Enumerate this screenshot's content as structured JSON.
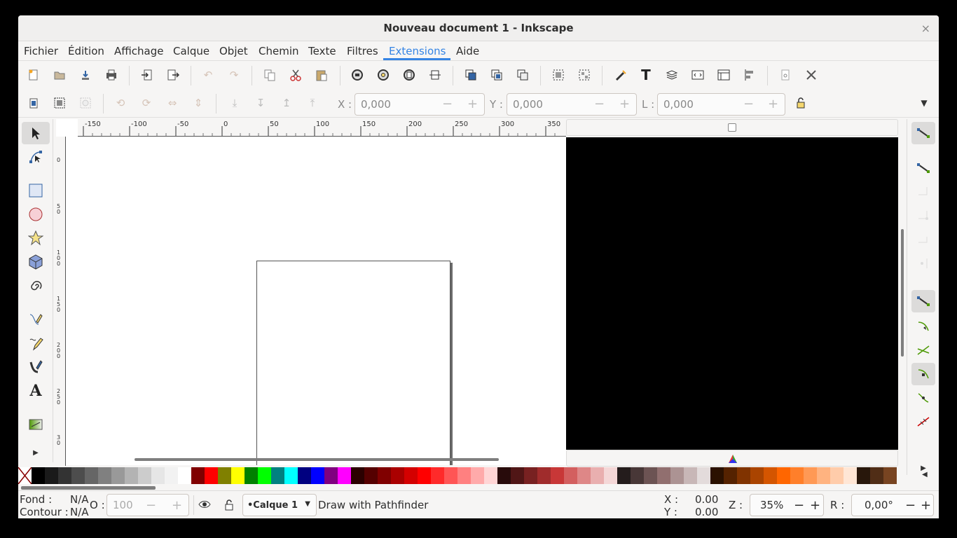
{
  "window": {
    "title": "Nouveau document 1 - Inkscape",
    "close_glyph": "×"
  },
  "menu": {
    "items": [
      "Fichier",
      "Édition",
      "Affichage",
      "Calque",
      "Objet",
      "Chemin",
      "Texte",
      "Filtres",
      "Extensions",
      "Aide"
    ],
    "active": "Extensions",
    "accent": "#3584e4"
  },
  "coords": {
    "x_label": "X :",
    "x_value": "0,000",
    "y_label": "Y :",
    "y_value": "0,000",
    "l_label": "L :",
    "l_value": "0,000"
  },
  "ruler": {
    "h_ticks": [
      "-150",
      "-100",
      "-50",
      "0",
      "50",
      "100",
      "150",
      "200",
      "250",
      "300",
      "350"
    ],
    "v_ticks": [
      "0",
      "5\n0",
      "1\n0\n0",
      "1\n5\n0",
      "2\n0\n0",
      "2\n5\n0",
      "3\n0"
    ]
  },
  "status": {
    "fill_label": "Fond :",
    "fill_value": "N/A",
    "stroke_label": "Contour :",
    "stroke_value": "N/A",
    "opacity_label": "O :",
    "opacity_value": "100",
    "layer": "•Calque 1",
    "message": "Draw with Pathfinder",
    "x_label": "X :",
    "x_value": "0.00",
    "y_label": "Y :",
    "y_value": "0.00",
    "zoom_label": "Z :",
    "zoom_value": "35%",
    "rotation_label": "R :",
    "rotation_value": "0,00°"
  },
  "palette": [
    "#000000",
    "#1a1a1a",
    "#333333",
    "#4d4d4d",
    "#666666",
    "#808080",
    "#999999",
    "#b3b3b3",
    "#cccccc",
    "#e6e6e6",
    "#f2f2f2",
    "#ffffff",
    "#800000",
    "#ff0000",
    "#808000",
    "#ffff00",
    "#008000",
    "#00ff00",
    "#008080",
    "#00ffff",
    "#000080",
    "#0000ff",
    "#800080",
    "#ff00ff",
    "#2b0000",
    "#550000",
    "#800000",
    "#aa0000",
    "#d40000",
    "#ff0000",
    "#ff2a2a",
    "#ff5555",
    "#ff8080",
    "#ffaaaa",
    "#ffd5d5",
    "#280b0b",
    "#501616",
    "#782121",
    "#a02c2c",
    "#c83737",
    "#d35f5f",
    "#de8787",
    "#e9afaf",
    "#f4d7d7",
    "#241c1c",
    "#483737",
    "#6c5353",
    "#916f6f",
    "#ac9393",
    "#c8b7b7",
    "#e3dbdb",
    "#2b1100",
    "#552200",
    "#803300",
    "#aa4400",
    "#d45500",
    "#ff6600",
    "#ff7f2a",
    "#ff9955",
    "#ffb380",
    "#ffccaa",
    "#ffe6d5",
    "#28170b",
    "#502d16",
    "#784421"
  ]
}
